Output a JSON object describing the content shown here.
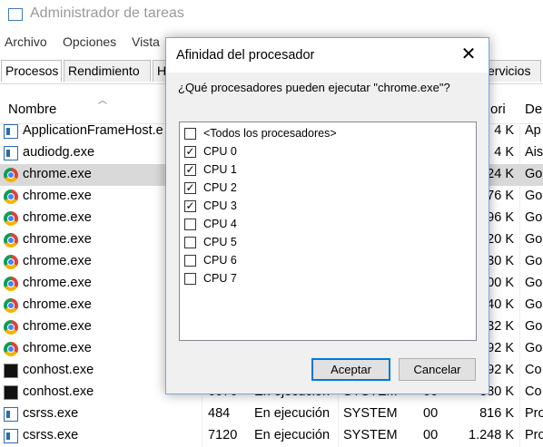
{
  "window": {
    "title": "Administrador de tareas"
  },
  "menu": [
    "Archivo",
    "Opciones",
    "Vista"
  ],
  "tabs": [
    "Procesos",
    "Rendimiento",
    "H",
    "ervicios"
  ],
  "columns": {
    "name": "Nombre",
    "memory_partial": "ori",
    "description_partial": "De"
  },
  "processes": [
    {
      "icon": "window-icon",
      "name": "ApplicationFrameHost.e",
      "pid": "",
      "status": "",
      "user": "",
      "cpu": "",
      "memory": "4 K",
      "desc": "Ap"
    },
    {
      "icon": "window-icon",
      "name": "audiodg.exe",
      "pid": "",
      "status": "",
      "user": "",
      "cpu": "",
      "memory": "4 K",
      "desc": "Ais"
    },
    {
      "icon": "chrome-icon",
      "name": "chrome.exe",
      "pid": "",
      "status": "",
      "user": "",
      "cpu": "",
      "memory": "24 K",
      "desc": "Go",
      "selected": true
    },
    {
      "icon": "chrome-icon",
      "name": "chrome.exe",
      "pid": "",
      "status": "",
      "user": "",
      "cpu": "",
      "memory": "76 K",
      "desc": "Go"
    },
    {
      "icon": "chrome-icon",
      "name": "chrome.exe",
      "pid": "",
      "status": "",
      "user": "",
      "cpu": "",
      "memory": "96 K",
      "desc": "Go"
    },
    {
      "icon": "chrome-icon",
      "name": "chrome.exe",
      "pid": "",
      "status": "",
      "user": "",
      "cpu": "",
      "memory": "20 K",
      "desc": "Go"
    },
    {
      "icon": "chrome-icon",
      "name": "chrome.exe",
      "pid": "",
      "status": "",
      "user": "",
      "cpu": "",
      "memory": "30 K",
      "desc": "Go"
    },
    {
      "icon": "chrome-icon",
      "name": "chrome.exe",
      "pid": "",
      "status": "",
      "user": "",
      "cpu": "",
      "memory": "00 K",
      "desc": "Go"
    },
    {
      "icon": "chrome-icon",
      "name": "chrome.exe",
      "pid": "",
      "status": "",
      "user": "",
      "cpu": "",
      "memory": "40 K",
      "desc": "Go"
    },
    {
      "icon": "chrome-icon",
      "name": "chrome.exe",
      "pid": "",
      "status": "",
      "user": "",
      "cpu": "",
      "memory": "32 K",
      "desc": "Go"
    },
    {
      "icon": "chrome-icon",
      "name": "chrome.exe",
      "pid": "",
      "status": "",
      "user": "",
      "cpu": "",
      "memory": "92 K",
      "desc": "Go"
    },
    {
      "icon": "console-icon",
      "name": "conhost.exe",
      "pid": "",
      "status": "",
      "user": "",
      "cpu": "",
      "memory": "92 K",
      "desc": "Co"
    },
    {
      "icon": "console-icon",
      "name": "conhost.exe",
      "pid": "6076",
      "status": "En ejecución",
      "user": "SYSTEM",
      "cpu": "00",
      "memory": "380 K",
      "desc": "Co"
    },
    {
      "icon": "window-icon",
      "name": "csrss.exe",
      "pid": "484",
      "status": "En ejecución",
      "user": "SYSTEM",
      "cpu": "00",
      "memory": "816 K",
      "desc": "Pro"
    },
    {
      "icon": "window-icon",
      "name": "csrss.exe",
      "pid": "7120",
      "status": "En ejecución",
      "user": "SYSTEM",
      "cpu": "00",
      "memory": "1.248 K",
      "desc": "Pro"
    }
  ],
  "dialog": {
    "title": "Afinidad del procesador",
    "question": "¿Qué procesadores pueden ejecutar \"chrome.exe\"?",
    "items": [
      {
        "label": "<Todos los procesadores>",
        "checked": false
      },
      {
        "label": "CPU 0",
        "checked": true
      },
      {
        "label": "CPU 1",
        "checked": true
      },
      {
        "label": "CPU 2",
        "checked": true
      },
      {
        "label": "CPU 3",
        "checked": true
      },
      {
        "label": "CPU 4",
        "checked": false
      },
      {
        "label": "CPU 5",
        "checked": false
      },
      {
        "label": "CPU 6",
        "checked": false
      },
      {
        "label": "CPU 7",
        "checked": false
      }
    ],
    "ok_label": "Aceptar",
    "cancel_label": "Cancelar"
  }
}
